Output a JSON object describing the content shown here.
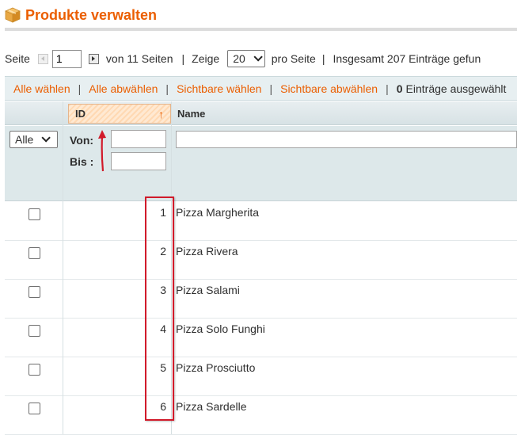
{
  "header": {
    "title": "Produkte verwalten",
    "icon": "box-icon"
  },
  "pager": {
    "page_label": "Seite",
    "page_value": "1",
    "of_pages": "von 11 Seiten",
    "sep1": "|",
    "show_label": "Zeige",
    "per_page_value": "20",
    "per_page_suffix": "pro Seite",
    "sep2": "|",
    "total_text": "Insgesamt 207 Einträge gefun"
  },
  "massactions": {
    "select_all": "Alle wählen",
    "unselect_all": "Alle abwählen",
    "select_visible": "Sichtbare wählen",
    "unselect_visible": "Sichtbare abwählen",
    "separator": "|",
    "selected_count": "0",
    "selected_suffix": "Einträge ausgewählt"
  },
  "grid": {
    "columns": {
      "id": "ID",
      "name": "Name"
    },
    "filter": {
      "any_select": "Alle",
      "from_label": "Von:",
      "to_label": "Bis :"
    },
    "rows": [
      {
        "id": "1",
        "name": "Pizza Margherita"
      },
      {
        "id": "2",
        "name": "Pizza Rivera"
      },
      {
        "id": "3",
        "name": "Pizza Salami"
      },
      {
        "id": "4",
        "name": "Pizza Solo Funghi"
      },
      {
        "id": "5",
        "name": "Pizza Prosciutto"
      },
      {
        "id": "6",
        "name": "Pizza Sardelle"
      }
    ]
  },
  "colors": {
    "accent": "#eb5e00",
    "highlight": "#d11a2a",
    "header_bg": "#dde8ea"
  }
}
